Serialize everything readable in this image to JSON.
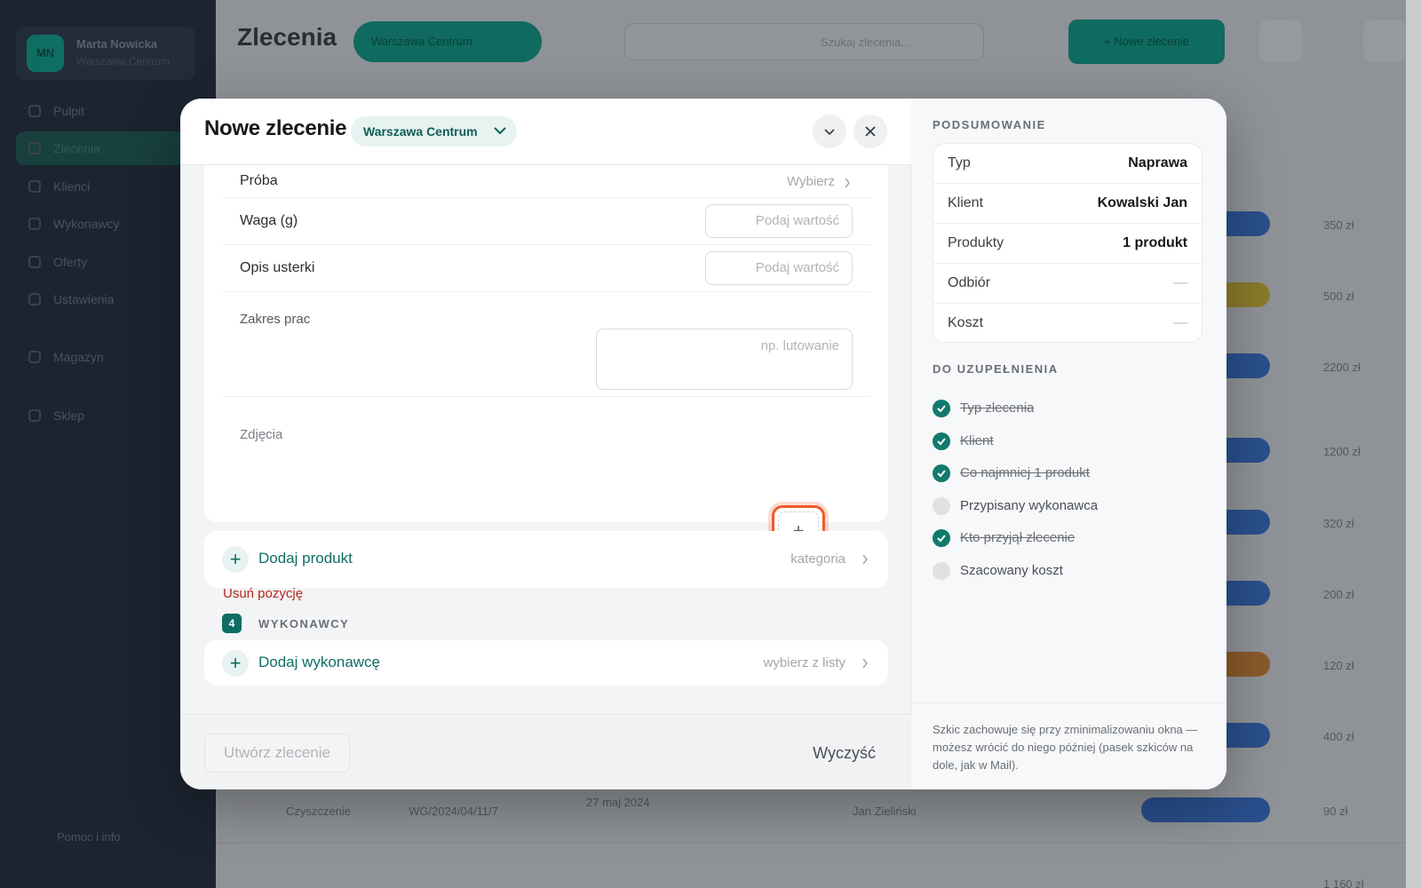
{
  "background": {
    "user": {
      "initials": "MN",
      "name": "Marta Nowicka",
      "role": "Warszawa Centrum"
    },
    "nav": [
      "Pulpit",
      "Zlecenia",
      "Klienci",
      "Wykonawcy",
      "Oferty",
      "Ustawienia",
      "Magazyn",
      "Sklep"
    ],
    "help": "Pomoc i info",
    "title": "Zlecenia",
    "location": "Warszawa Centrum",
    "search_placeholder": "Szukaj zlecenia...",
    "new_order": "+ Nowe zlecenie",
    "prices": [
      "350 zł",
      "500 zł",
      "2200 zł",
      "1200 zł",
      "320 zł",
      "200 zł",
      "120 zł",
      "400 zł",
      "90 zł",
      "1 160 zł"
    ],
    "row_type": "Czyszczenie",
    "row_code": "WG/2024/04/11/7",
    "row_date": "27 maj 2024",
    "row_name": "Jan Zieliński"
  },
  "modal": {
    "title": "Nowe zlecenie",
    "location": "Warszawa Centrum",
    "fields": {
      "proba": {
        "label": "Próba",
        "value": "Wybierz"
      },
      "waga": {
        "label": "Waga (g)",
        "placeholder": "Podaj wartość"
      },
      "opis": {
        "label": "Opis usterki",
        "placeholder": "Podaj wartość"
      },
      "zakres": {
        "label": "Zakres prac",
        "placeholder": "np. lutowanie"
      },
      "zdjecia": {
        "label": "Zdjęcia",
        "add": "+"
      }
    },
    "remove_item": "Usuń pozycję",
    "add_product": {
      "label": "Dodaj produkt",
      "hint": "kategoria"
    },
    "step4": {
      "number": "4",
      "label": "WYKONAWCY"
    },
    "add_contractor": {
      "label": "Dodaj wykonawcę",
      "hint": "wybierz z listy"
    },
    "footer": {
      "create": "Utwórz zlecenie",
      "clear": "Wyczyść"
    }
  },
  "summary": {
    "heading": "PODSUMOWANIE",
    "rows": [
      {
        "key": "Typ",
        "value": "Naprawa"
      },
      {
        "key": "Klient",
        "value": "Kowalski Jan"
      },
      {
        "key": "Produkty",
        "value": "1 produkt"
      },
      {
        "key": "Odbiór",
        "value": "—"
      },
      {
        "key": "Koszt",
        "value": "—"
      }
    ],
    "todo_heading": "DO UZUPEŁNIENIA",
    "todo": [
      {
        "label": "Typ zlecenia",
        "done": true
      },
      {
        "label": "Klient",
        "done": true
      },
      {
        "label": "Co najmniej 1 produkt",
        "done": true
      },
      {
        "label": "Przypisany wykonawca",
        "done": false
      },
      {
        "label": "Kto przyjął zlecenie",
        "done": true
      },
      {
        "label": "Szacowany koszt",
        "done": false
      }
    ],
    "note": "Szkic zachowuje się przy zminimalizowaniu okna — możesz wrócić do niego później (pasek szkiców na dole, jak w Mail)."
  },
  "colors": {
    "accent": "#0f6e63",
    "focus": "#ee5a2a",
    "danger": "#b3261e"
  }
}
